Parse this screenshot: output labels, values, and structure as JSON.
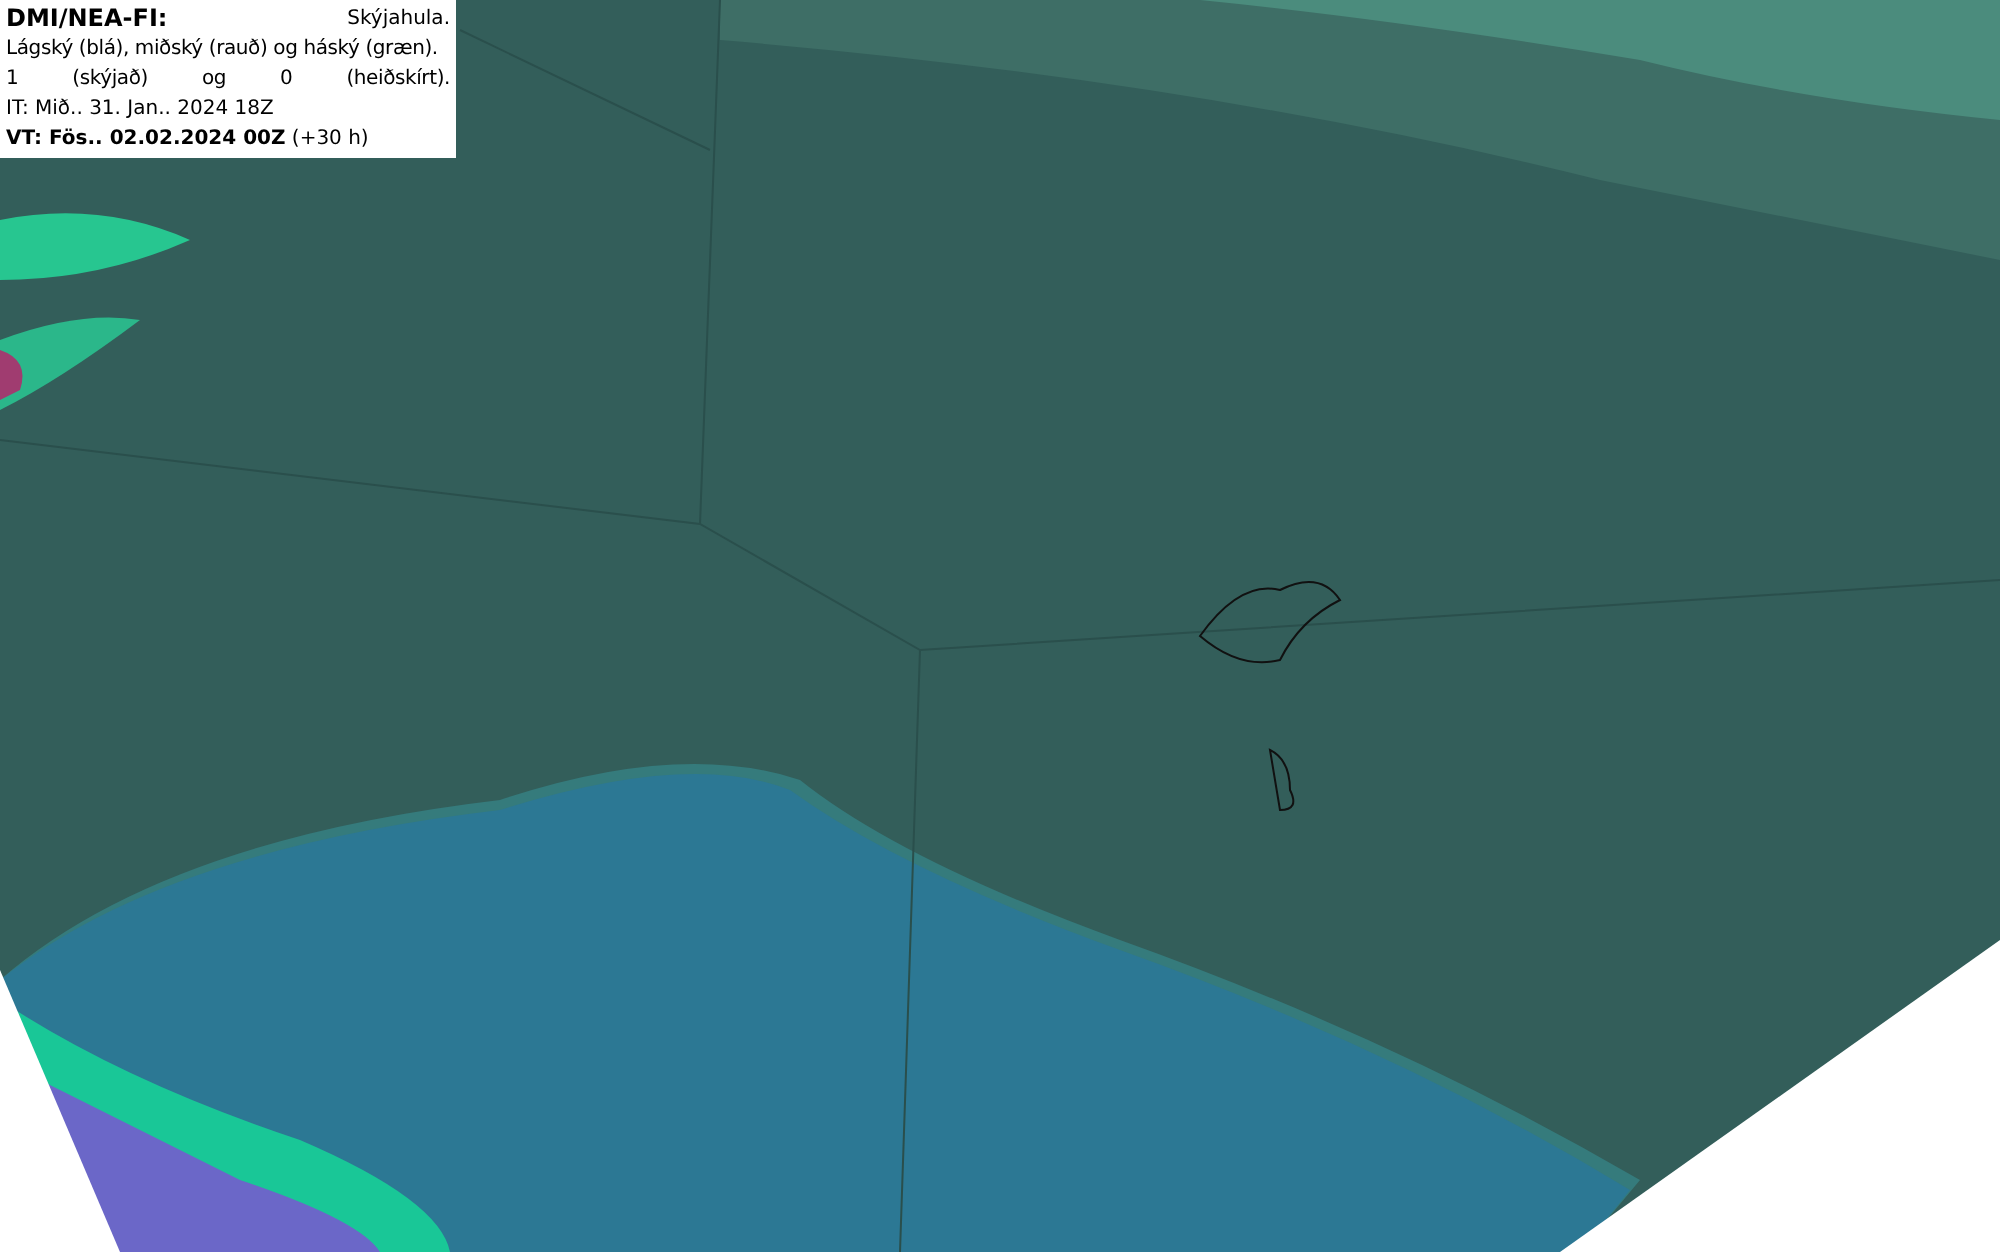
{
  "legend": {
    "title": "DMI/NEA-FI:",
    "subtitle": "Skýjahula.",
    "description_lines": [
      "Lágský (blá), miðský (rauð) og háský (græn).",
      "1 (skýjað) og 0 (heiðskírt)."
    ],
    "issue_time": "IT: Mið.. 31. Jan.. 2024 18Z",
    "valid_time": "**VT: Fös.. 02.02.2024 00Z** (+30 h)"
  }
}
